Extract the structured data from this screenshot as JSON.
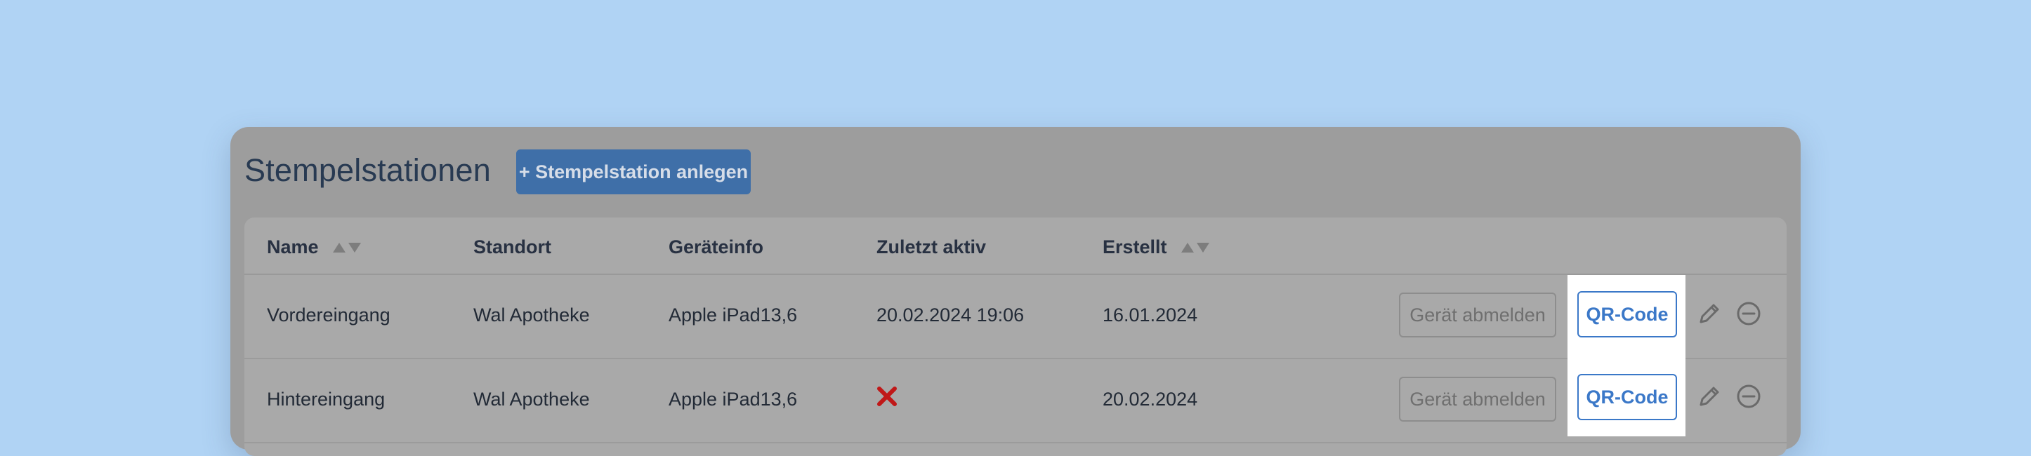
{
  "header": {
    "title": "Stempelstationen",
    "add_label": "+ Stempelstation anlegen"
  },
  "table": {
    "columns": {
      "name": "Name",
      "standort": "Standort",
      "geraeteinfo": "Geräteinfo",
      "zuletzt_aktiv": "Zuletzt aktiv",
      "erstellt": "Erstellt"
    },
    "rows": [
      {
        "name": "Vordereingang",
        "standort": "Wal Apotheke",
        "geraeteinfo": "Apple iPad13,6",
        "zuletzt_aktiv": "20.02.2024 19:06",
        "erstellt": "16.01.2024"
      },
      {
        "name": "Hintereingang",
        "standort": "Wal Apotheke",
        "geraeteinfo": "Apple iPad13,6",
        "zuletzt_aktiv_icon": "x-icon",
        "erstellt": "20.02.2024"
      }
    ],
    "actions": {
      "logout_label": "Gerät abmelden",
      "qr_label": "QR-Code",
      "edit_icon": "pencil-icon",
      "remove_icon": "minus-circle-icon"
    }
  },
  "colors": {
    "background": "#b0d3f4",
    "accent": "#3b78c8",
    "primary_button": "#3f6fa8",
    "error": "#c01818"
  }
}
